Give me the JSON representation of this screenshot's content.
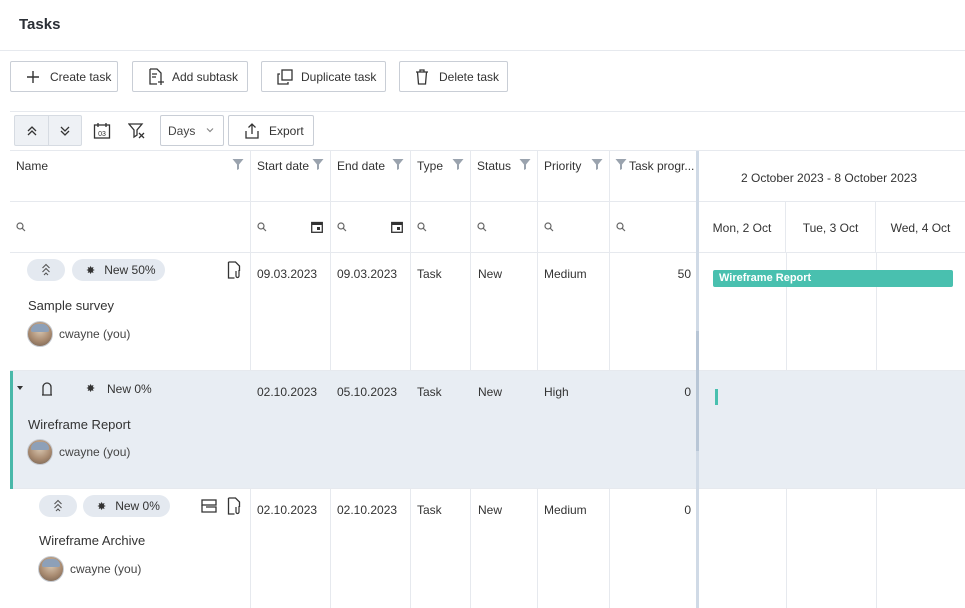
{
  "app": {
    "title": "Tasks"
  },
  "actions": {
    "create": "Create task",
    "add_subtask": "Add subtask",
    "duplicate": "Duplicate task",
    "delete": "Delete task"
  },
  "toolbar": {
    "scale": "Days",
    "export": "Export",
    "calendar_icon_text": "03"
  },
  "columns": [
    "Name",
    "Start date",
    "End date",
    "Type",
    "Status",
    "Priority",
    "Task progr..."
  ],
  "gantt": {
    "range": "2 October 2023 - 8 October 2023",
    "days": [
      "Mon, 2 Oct",
      "Tue, 3 Oct",
      "Wed, 4 Oct"
    ],
    "bar_label": "Wireframe Report"
  },
  "rows": [
    {
      "name": "Sample survey",
      "status_pill": "New 50%",
      "user": "cwayne (you)",
      "start": "09.03.2023",
      "end": "09.03.2023",
      "type": "Task",
      "status": "New",
      "priority": "Medium",
      "progress": "50"
    },
    {
      "name": "Wireframe Report",
      "status_pill": "New 0%",
      "user": "cwayne (you)",
      "start": "02.10.2023",
      "end": "05.10.2023",
      "type": "Task",
      "status": "New",
      "priority": "High",
      "progress": "0"
    },
    {
      "name": "Wireframe Archive",
      "status_pill": "New 0%",
      "user": "cwayne (you)",
      "start": "02.10.2023",
      "end": "02.10.2023",
      "type": "Task",
      "status": "New",
      "priority": "Medium",
      "progress": "0"
    }
  ],
  "colors": {
    "accent": "#49c0af",
    "selected_row": "#e8edf3",
    "border": "#e6e9ee"
  }
}
